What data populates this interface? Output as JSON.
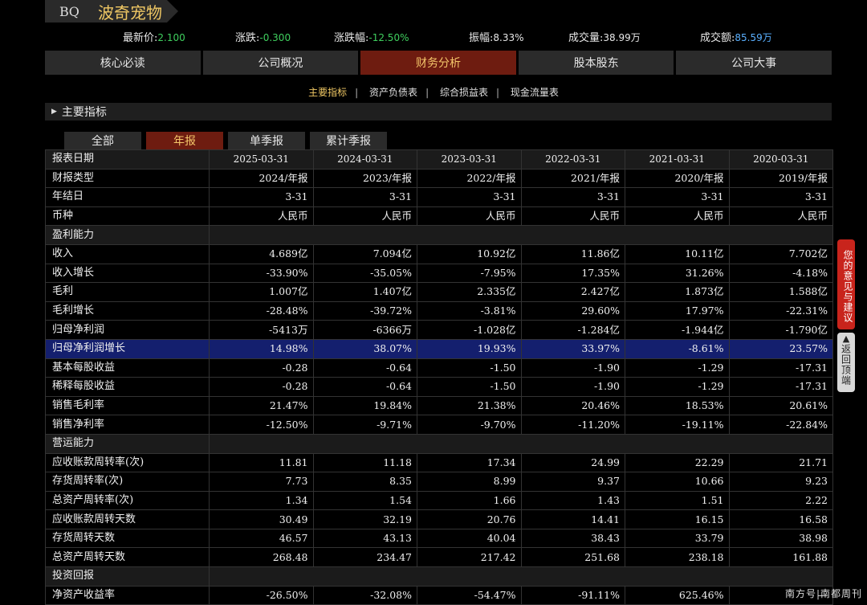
{
  "stock": {
    "code": "BQ",
    "name": "波奇宠物"
  },
  "quote": {
    "latest_label": "最新价:",
    "latest_value": "2.100",
    "change_label": "涨跌:",
    "change_value": "-0.300",
    "pct_label": "涨跌幅:",
    "pct_value": "-12.50%",
    "amp_label": "振幅:",
    "amp_value": "8.33%",
    "vol_label": "成交量:",
    "vol_value": "38.99万",
    "amt_label": "成交额:",
    "amt_value": "85.59万"
  },
  "nav": [
    "核心必读",
    "公司概况",
    "财务分析",
    "股本股东",
    "公司大事"
  ],
  "subnav": [
    "主要指标",
    "资产负债表",
    "综合损益表",
    "现金流量表"
  ],
  "section_title": "主要指标",
  "period_tabs": [
    "全部",
    "年报",
    "单季报",
    "累计季报"
  ],
  "table": {
    "head": [
      "报表日期",
      "2025-03-31",
      "2024-03-31",
      "2023-03-31",
      "2022-03-31",
      "2021-03-31",
      "2020-03-31"
    ],
    "rows": [
      {
        "type": "row",
        "cells": [
          "财报类型",
          "2024/年报",
          "2023/年报",
          "2022/年报",
          "2021/年报",
          "2020/年报",
          "2019/年报"
        ]
      },
      {
        "type": "row",
        "cells": [
          "年结日",
          "3-31",
          "3-31",
          "3-31",
          "3-31",
          "3-31",
          "3-31"
        ]
      },
      {
        "type": "row",
        "cells": [
          "币种",
          "人民币",
          "人民币",
          "人民币",
          "人民币",
          "人民币",
          "人民币"
        ]
      },
      {
        "type": "group",
        "cells": [
          "盈利能力"
        ]
      },
      {
        "type": "row",
        "cells": [
          "收入",
          "4.689亿",
          "7.094亿",
          "10.92亿",
          "11.86亿",
          "10.11亿",
          "7.702亿"
        ]
      },
      {
        "type": "row",
        "cells": [
          "收入增长",
          "-33.90%",
          "-35.05%",
          "-7.95%",
          "17.35%",
          "31.26%",
          "-4.18%"
        ]
      },
      {
        "type": "row",
        "cells": [
          "毛利",
          "1.007亿",
          "1.407亿",
          "2.335亿",
          "2.427亿",
          "1.873亿",
          "1.588亿"
        ]
      },
      {
        "type": "row",
        "cells": [
          "毛利增长",
          "-28.48%",
          "-39.72%",
          "-3.81%",
          "29.60%",
          "17.97%",
          "-22.31%"
        ]
      },
      {
        "type": "row",
        "cells": [
          "归母净利润",
          "-5413万",
          "-6366万",
          "-1.028亿",
          "-1.284亿",
          "-1.944亿",
          "-1.790亿"
        ]
      },
      {
        "type": "hl",
        "cells": [
          "归母净利润增长",
          "14.98%",
          "38.07%",
          "19.93%",
          "33.97%",
          "-8.61%",
          "23.57%"
        ]
      },
      {
        "type": "row",
        "cells": [
          "基本每股收益",
          "-0.28",
          "-0.64",
          "-1.50",
          "-1.90",
          "-1.29",
          "-17.31"
        ]
      },
      {
        "type": "row",
        "cells": [
          "稀释每股收益",
          "-0.28",
          "-0.64",
          "-1.50",
          "-1.90",
          "-1.29",
          "-17.31"
        ]
      },
      {
        "type": "row",
        "cells": [
          "销售毛利率",
          "21.47%",
          "19.84%",
          "21.38%",
          "20.46%",
          "18.53%",
          "20.61%"
        ]
      },
      {
        "type": "row",
        "cells": [
          "销售净利率",
          "-12.50%",
          "-9.71%",
          "-9.70%",
          "-11.20%",
          "-19.11%",
          "-22.84%"
        ]
      },
      {
        "type": "group",
        "cells": [
          "营运能力"
        ]
      },
      {
        "type": "row",
        "cells": [
          "应收账款周转率(次)",
          "11.81",
          "11.18",
          "17.34",
          "24.99",
          "22.29",
          "21.71"
        ]
      },
      {
        "type": "row",
        "cells": [
          "存货周转率(次)",
          "7.73",
          "8.35",
          "8.99",
          "9.37",
          "10.66",
          "9.23"
        ]
      },
      {
        "type": "row",
        "cells": [
          "总资产周转率(次)",
          "1.34",
          "1.54",
          "1.66",
          "1.43",
          "1.51",
          "2.22"
        ]
      },
      {
        "type": "row",
        "cells": [
          "应收账款周转天数",
          "30.49",
          "32.19",
          "20.76",
          "14.41",
          "16.15",
          "16.58"
        ]
      },
      {
        "type": "row",
        "cells": [
          "存货周转天数",
          "46.57",
          "43.13",
          "40.04",
          "38.43",
          "33.79",
          "38.98"
        ]
      },
      {
        "type": "row",
        "cells": [
          "总资产周转天数",
          "268.48",
          "234.47",
          "217.42",
          "251.68",
          "238.18",
          "161.88"
        ]
      },
      {
        "type": "group",
        "cells": [
          "投资回报"
        ]
      },
      {
        "type": "row",
        "cells": [
          "净资产收益率",
          "-26.50%",
          "-32.08%",
          "-54.47%",
          "-91.11%",
          "625.46%",
          "—"
        ]
      }
    ]
  },
  "side": {
    "feedback": "您的意见与建议",
    "top": "返回顶端",
    "top_arrow": "▲"
  },
  "watermark": "南方号|南都周刊",
  "colors": {
    "accent_tab": "#6e1c10",
    "gold": "#f0c864",
    "highlight_row": "#141f6e",
    "down": "#3fcf5e",
    "volume": "#5ab0ff"
  }
}
